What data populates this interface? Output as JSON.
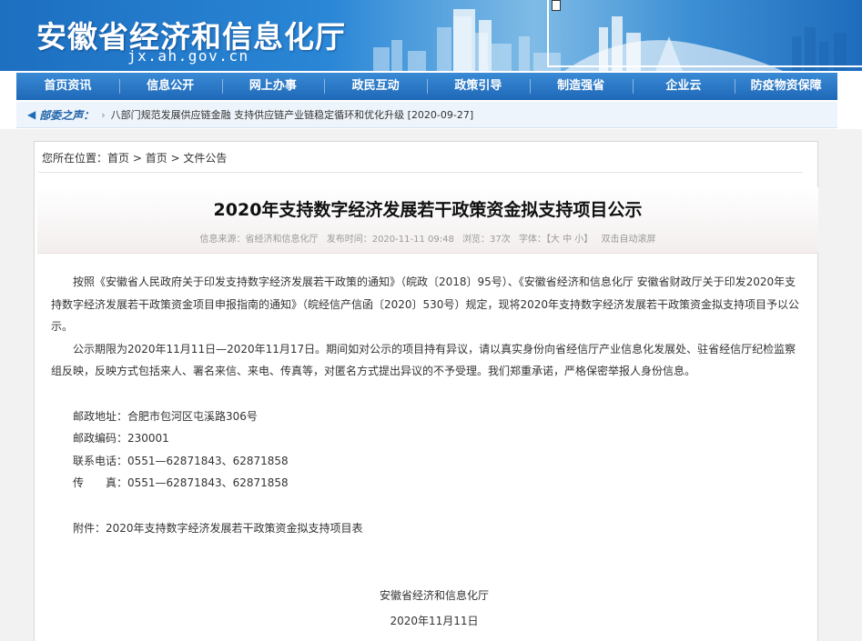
{
  "header": {
    "title": "安徽省经济和信息化厅",
    "domain": "jx.ah.gov.cn"
  },
  "nav": {
    "items": [
      "首页资讯",
      "信息公开",
      "网上办事",
      "政民互动",
      "政策引导",
      "制造强省",
      "企业云",
      "防疫物资保障"
    ]
  },
  "ticker": {
    "label": "部委之声：",
    "separator": "›",
    "text": "八部门规范发展供应链金融 支持供应链产业链稳定循环和优化升级 [2020-09-27]"
  },
  "breadcrumb": {
    "prefix": "您所在位置：",
    "items": [
      "首页",
      "首页",
      "文件公告"
    ],
    "sep": " > "
  },
  "article": {
    "title": "2020年支持数字经济发展若干政策资金拟支持项目公示",
    "meta": {
      "source": "信息来源：省经济和信息化厅",
      "published": "发布时间：2020-11-11 09:48",
      "views": "浏览：37次",
      "font_label": "字体：",
      "font_sizes": "【大 中 小】",
      "autoscroll": "双击自动滚屏"
    },
    "paragraphs": [
      "按照《安徽省人民政府关于印发支持数字经济发展若干政策的通知》（皖政〔2018〕95号）、《安徽省经济和信息化厅 安徽省财政厅关于印发2020年支持数字经济发展若干政策资金项目申报指南的通知》（皖经信产信函〔2020〕530号）规定，现将2020年支持数字经济发展若干政策资金拟支持项目予以公示。",
      "公示期限为2020年11月11日—2020年11月17日。期间如对公示的项目持有异议，请以真实身份向省经信厅产业信息化发展处、驻省经信厅纪检监察组反映，反映方式包括来人、署名来信、来电、传真等，对匿名方式提出异议的不予受理。我们郑重承诺，严格保密举报人身份信息。"
    ],
    "contact": [
      "邮政地址：合肥市包河区屯溪路306号",
      "邮政编码：230001",
      "联系电话：0551—62871843、62871858",
      "传　　真：0551—62871843、62871858"
    ],
    "attachment": "附件：2020年支持数字经济发展若干政策资金拟支持项目表",
    "sign_org": "安徽省经济和信息化厅",
    "sign_date": "2020年11月11日"
  },
  "colors": {
    "nav_blue": "#1e69b7",
    "banner_blue": "#2a86d6",
    "ticker_label": "#1f63a8"
  }
}
